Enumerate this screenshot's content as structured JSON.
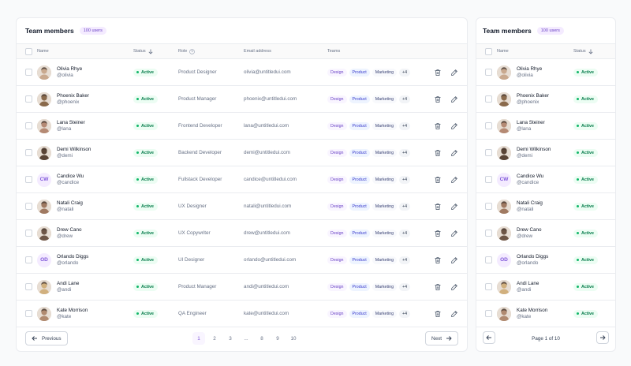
{
  "table": {
    "title": "Team members",
    "count_badge": "100 users",
    "columns": {
      "name": "Name",
      "status": "Status",
      "role": "Role",
      "email": "Email address",
      "teams": "Teams"
    }
  },
  "tags": {
    "design": "Design",
    "product": "Product",
    "marketing": "Marketing",
    "more": "+4"
  },
  "rows": [
    {
      "name": "Olivia Rhye",
      "handle": "@olivia",
      "status": "Active",
      "role": "Product Designer",
      "email": "olivia@untitledui.com",
      "avatar": "photo",
      "tone": "#c9a98f"
    },
    {
      "name": "Phoenix Baker",
      "handle": "@phoenix",
      "status": "Active",
      "role": "Product Manager",
      "email": "phoenix@untitledui.com",
      "avatar": "photo",
      "tone": "#8a6a4c"
    },
    {
      "name": "Lana Steiner",
      "handle": "@lana",
      "status": "Active",
      "role": "Frontend Developer",
      "email": "lana@untitledui.com",
      "avatar": "photo",
      "tone": "#b58a74"
    },
    {
      "name": "Demi Wilkinson",
      "handle": "@demi",
      "status": "Active",
      "role": "Backend Developer",
      "email": "demi@untitledui.com",
      "avatar": "photo",
      "tone": "#5a4436"
    },
    {
      "name": "Candice Wu",
      "handle": "@candice",
      "status": "Active",
      "role": "Fullstack Developer",
      "email": "candice@untitledui.com",
      "avatar": "initials",
      "initials": "CW"
    },
    {
      "name": "Natali Craig",
      "handle": "@natali",
      "status": "Active",
      "role": "UX Designer",
      "email": "natali@untitledui.com",
      "avatar": "photo",
      "tone": "#a07a62"
    },
    {
      "name": "Drew Cano",
      "handle": "@drew",
      "status": "Active",
      "role": "UX Copywriter",
      "email": "drew@untitledui.com",
      "avatar": "photo",
      "tone": "#6e5646"
    },
    {
      "name": "Orlando Diggs",
      "handle": "@orlando",
      "status": "Active",
      "role": "UI Designer",
      "email": "orlando@untitledui.com",
      "avatar": "initials",
      "initials": "OD"
    },
    {
      "name": "Andi Lane",
      "handle": "@andi",
      "status": "Active",
      "role": "Product Manager",
      "email": "andi@untitledui.com",
      "avatar": "photo",
      "tone": "#d1b07e"
    },
    {
      "name": "Kate Morrison",
      "handle": "@kate",
      "status": "Active",
      "role": "QA Engineer",
      "email": "kate@untitledui.com",
      "avatar": "photo",
      "tone": "#b08a70"
    }
  ],
  "pagination": {
    "previous": "Previous",
    "next": "Next",
    "pages": [
      "1",
      "2",
      "3",
      "...",
      "8",
      "9",
      "10"
    ],
    "current": "1",
    "mobile_label": "Page 1 of 10"
  },
  "colors": {
    "accent": "#7f56d9",
    "success": "#12b76a"
  },
  "icons": [
    "arrow-down-icon",
    "help-circle-icon",
    "trash-icon",
    "edit-pencil-icon",
    "arrow-left-icon",
    "arrow-right-icon"
  ]
}
